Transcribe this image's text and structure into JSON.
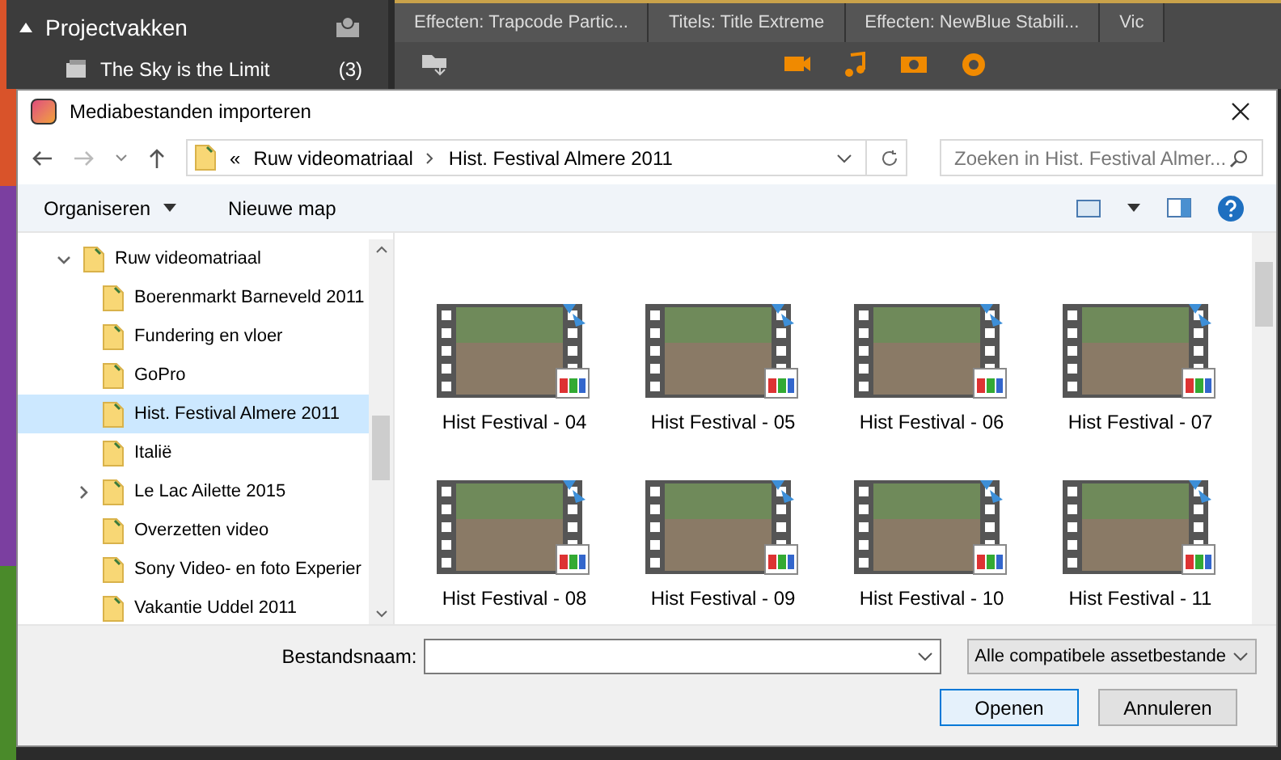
{
  "app": {
    "panel_title": "Projectvakken",
    "project": {
      "name": "The Sky is the Limit",
      "count": "(3)"
    },
    "tabs": [
      {
        "label": "Effecten: Trapcode Partic..."
      },
      {
        "label": "Titels: Title Extreme"
      },
      {
        "label": "Effecten: NewBlue Stabili..."
      },
      {
        "label": "Vic"
      }
    ]
  },
  "dialog": {
    "title": "Mediabestanden importeren",
    "address": {
      "prefix": "«",
      "crumbs": [
        "Ruw videomatriaal",
        "Hist. Festival Almere 2011"
      ]
    },
    "search": {
      "placeholder": "Zoeken in Hist. Festival Almer..."
    },
    "toolbar": [
      "Organiseren",
      "Nieuwe map"
    ],
    "tree": [
      {
        "label": "Ruw videomatriaal",
        "expandable": true,
        "expanded": true,
        "selected": false,
        "children": [
          {
            "label": "Boerenmarkt Barneveld 2011",
            "expandable": false,
            "expanded": false,
            "selected": false
          },
          {
            "label": "Fundering en vloer",
            "expandable": false,
            "expanded": false,
            "selected": false
          },
          {
            "label": "GoPro",
            "expandable": false,
            "expanded": false,
            "selected": false
          },
          {
            "label": "Hist. Festival Almere 2011",
            "expandable": false,
            "expanded": false,
            "selected": true
          },
          {
            "label": "Italië",
            "expandable": false,
            "expanded": false,
            "selected": false
          },
          {
            "label": "Le Lac Ailette 2015",
            "expandable": true,
            "expanded": false,
            "selected": false
          },
          {
            "label": "Overzetten video",
            "expandable": false,
            "expanded": false,
            "selected": false
          },
          {
            "label": "Sony Video- en foto Experier",
            "expandable": false,
            "expanded": false,
            "selected": false
          },
          {
            "label": "Vakantie Uddel 2011",
            "expandable": false,
            "expanded": false,
            "selected": false
          }
        ]
      }
    ],
    "files": [
      {
        "name": "Hist Festival - 04"
      },
      {
        "name": "Hist Festival - 05"
      },
      {
        "name": "Hist Festival - 06"
      },
      {
        "name": "Hist Festival - 07"
      },
      {
        "name": "Hist Festival - 08"
      },
      {
        "name": "Hist Festival - 09"
      },
      {
        "name": "Hist Festival - 10"
      },
      {
        "name": "Hist Festival - 11"
      }
    ],
    "filename": {
      "label": "Bestandsnaam:"
    },
    "filter": "Alle compatibele assetbestande",
    "buttons": [
      "Openen",
      "Annuleren"
    ]
  }
}
